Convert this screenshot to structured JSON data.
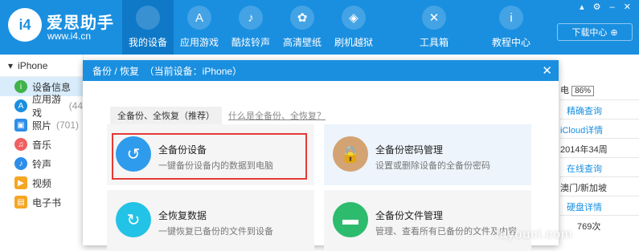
{
  "app": {
    "brand_name": "爱思助手",
    "brand_url": "www.i4.cn",
    "logo_text": "i4"
  },
  "nav": {
    "items": [
      {
        "label": "我的设备",
        "icon": "apple-icon",
        "glyph": "",
        "active": true
      },
      {
        "label": "应用游戏",
        "icon": "app-store-icon",
        "glyph": "A"
      },
      {
        "label": "酷炫铃声",
        "icon": "bell-icon",
        "glyph": "♪"
      },
      {
        "label": "高清壁纸",
        "icon": "flower-icon",
        "glyph": "✿"
      },
      {
        "label": "刷机越狱",
        "icon": "dropbox-icon",
        "glyph": "◈"
      },
      {
        "label": "工具箱",
        "icon": "tools-icon",
        "glyph": "✕"
      },
      {
        "label": "教程中心",
        "icon": "info-icon",
        "glyph": "i"
      }
    ],
    "download_label": "下载中心",
    "download_icon": "download-circle-icon"
  },
  "window_controls": {
    "icons": [
      "shirt-icon",
      "gear-icon",
      "minimize-icon",
      "close-icon"
    ],
    "glyphs": "▴ ⚙ – ✕"
  },
  "sidebar": {
    "device_name": "iPhone",
    "items": [
      {
        "label": "设备信息",
        "count": "",
        "icon": "info-green-icon",
        "glyph": "i",
        "color": "#3fb24a",
        "active": true
      },
      {
        "label": "应用游戏",
        "count": "(44",
        "icon": "app-store-icon",
        "glyph": "A",
        "color": "#1a8fe0"
      },
      {
        "label": "照片",
        "count": "(701)",
        "icon": "photo-icon",
        "glyph": "▣",
        "color": "#2d8ee8"
      },
      {
        "label": "音乐",
        "count": "",
        "icon": "music-icon",
        "glyph": "♫",
        "color": "#f06060"
      },
      {
        "label": "铃声",
        "count": "",
        "icon": "bell-icon",
        "glyph": "♪",
        "color": "#2d8ee8"
      },
      {
        "label": "视频",
        "count": "",
        "icon": "video-icon",
        "glyph": "▶",
        "color": "#f5a623"
      },
      {
        "label": "电子书",
        "count": "",
        "icon": "ebook-icon",
        "glyph": "▤",
        "color": "#f5a623"
      }
    ]
  },
  "background_panel": {
    "battery_label": "电",
    "battery_value": "86%",
    "precise_query": "精确查询",
    "icloud": "iCloud详情",
    "date": "2014年34周",
    "online_query": "在线查询",
    "region": "澳门/新加坡",
    "disk_detail": "硬盘详情",
    "count": "769次"
  },
  "dialog": {
    "title": "备份 / 恢复  （当前设备：iPhone）",
    "close_glyph": "✕",
    "mode_tab": "全备份、全恢复（推荐）",
    "mode_link": "什么是全备份、全恢复？",
    "cards": [
      {
        "title": "全备份设备",
        "desc": "一键备份设备内的数据到电脑",
        "icon": "backup-clock-icon",
        "glyph": "↺",
        "color": "#2f9bec"
      },
      {
        "title": "全备份密码管理",
        "desc": "设置或删除设备的全备份密码",
        "icon": "lock-icon",
        "glyph": "🔒",
        "color": "#d4a373"
      },
      {
        "title": "全恢复数据",
        "desc": "一键恢复已备份的文件到设备",
        "icon": "restore-icon",
        "glyph": "↻",
        "color": "#22c3e6"
      },
      {
        "title": "全备份文件管理",
        "desc": "管理、查看所有已备份的文件及内容",
        "icon": "folder-icon",
        "glyph": "▬",
        "color": "#2dbb6e"
      }
    ]
  },
  "watermark": "luyoucl.com"
}
